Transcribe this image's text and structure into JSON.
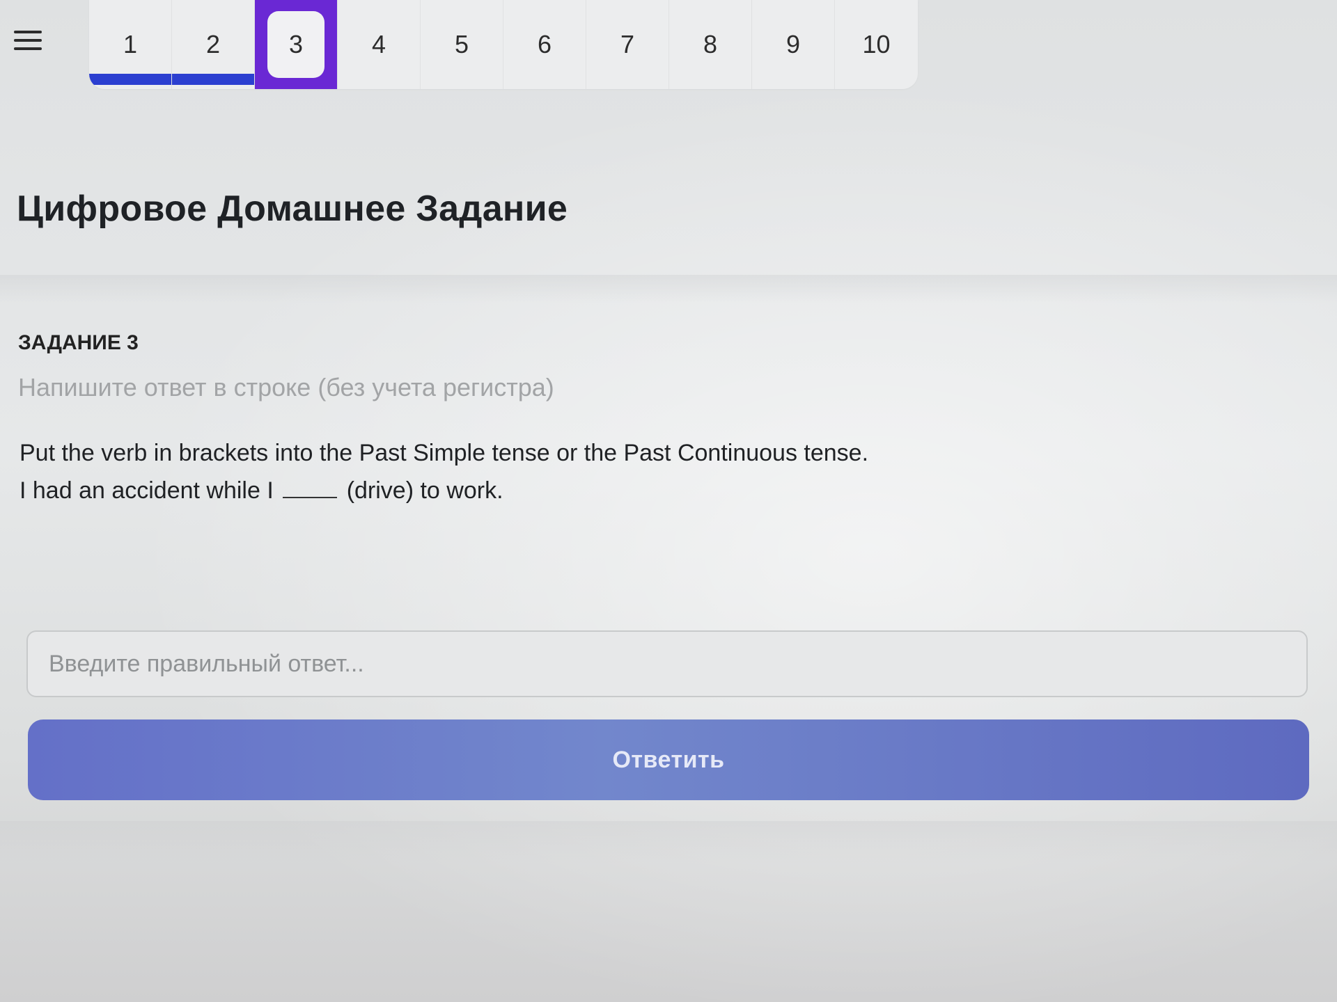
{
  "nav": {
    "menu_icon": "hamburger-menu-icon",
    "questions": [
      {
        "label": "1",
        "state": "done"
      },
      {
        "label": "2",
        "state": "done"
      },
      {
        "label": "3",
        "state": "active"
      },
      {
        "label": "4",
        "state": "pending"
      },
      {
        "label": "5",
        "state": "pending"
      },
      {
        "label": "6",
        "state": "pending"
      },
      {
        "label": "7",
        "state": "pending"
      },
      {
        "label": "8",
        "state": "pending"
      },
      {
        "label": "9",
        "state": "pending"
      },
      {
        "label": "10",
        "state": "pending"
      }
    ],
    "done_color": "#2b3fd0",
    "active_color": "#6a28d4"
  },
  "page": {
    "title": "Цифровое Домашнее Задание"
  },
  "task": {
    "label": "ЗАДАНИЕ 3",
    "hint": "Напишите ответ в строке (без учета регистра)",
    "instruction": "Put the verb in brackets into the Past Simple tense or the Past Continuous tense.",
    "sentence_before": "I had an accident while I",
    "sentence_after": "(drive) to work."
  },
  "answer": {
    "value": "",
    "placeholder": "Введите правильный ответ..."
  },
  "submit": {
    "label": "Ответить",
    "color": "#6a78c8"
  }
}
